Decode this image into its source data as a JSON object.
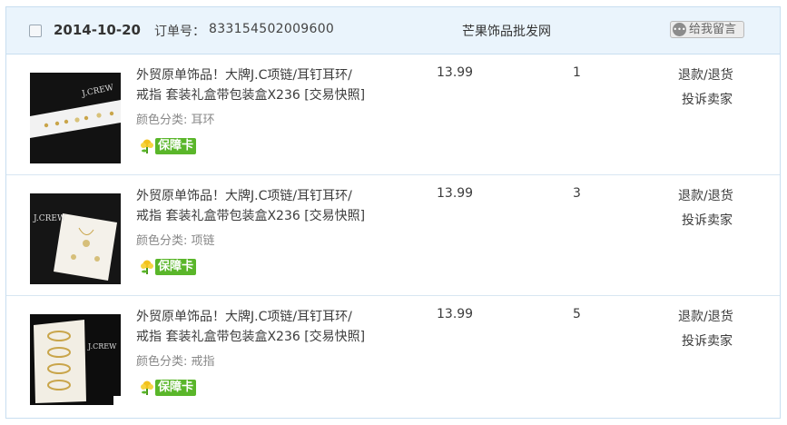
{
  "order": {
    "date": "2014-10-20",
    "order_label": "订单号：",
    "order_no": "833154502009600",
    "shop_name": "芒果饰品批发网",
    "message_button": "给我留言"
  },
  "items": [
    {
      "title_line1": "外贸原单饰品！大牌J.C项链/耳钉耳环/",
      "title_line2": "戒指 套装礼盒带包装盒X236 [交易快照]",
      "attr": "颜色分类: 耳环",
      "badge": "保障卡",
      "price": "13.99",
      "qty": "1",
      "refund": "退款/退货",
      "complain": "投诉卖家",
      "thumb_brand": "J.CREW"
    },
    {
      "title_line1": "外贸原单饰品！大牌J.C项链/耳钉耳环/",
      "title_line2": "戒指 套装礼盒带包装盒X236 [交易快照]",
      "attr": "颜色分类: 项链",
      "badge": "保障卡",
      "price": "13.99",
      "qty": "3",
      "refund": "退款/退货",
      "complain": "投诉卖家",
      "thumb_brand": "J.CREW"
    },
    {
      "title_line1": "外贸原单饰品！大牌J.C项链/耳钉耳环/",
      "title_line2": "戒指 套装礼盒带包装盒X236 [交易快照]",
      "attr": "颜色分类: 戒指",
      "badge": "保障卡",
      "price": "13.99",
      "qty": "5",
      "refund": "退款/退货",
      "complain": "投诉卖家",
      "thumb_brand": "J.CREW"
    }
  ],
  "icons": {
    "checkbox": "checkbox-icon",
    "message": "message-bubble-icon",
    "badge": "flower-icon"
  },
  "colors": {
    "header_bg": "#eaf4fc",
    "border": "#c8def0",
    "badge_green": "#5ab62a"
  }
}
